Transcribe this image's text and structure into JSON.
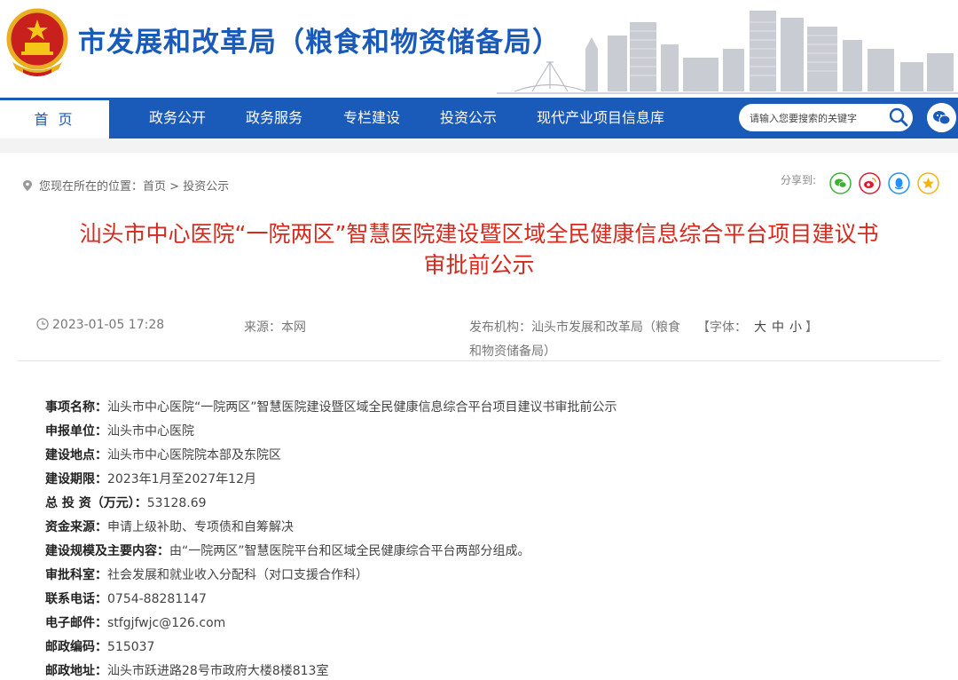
{
  "header": {
    "site_title": "市发展和改革局（粮食和物资储备局）"
  },
  "nav": {
    "items": [
      {
        "label": "首 页"
      },
      {
        "label": "政务公开"
      },
      {
        "label": "政务服务"
      },
      {
        "label": "专栏建设"
      },
      {
        "label": "投资公示"
      },
      {
        "label": "现代产业项目信息库"
      }
    ],
    "search_placeholder": "请输入您要搜索的关键字"
  },
  "breadcrumb": {
    "prefix": "您现在所在的位置：",
    "home": "首页",
    "sep": " > ",
    "current": "投资公示"
  },
  "share": {
    "label": "分享到:",
    "targets": [
      "wechat",
      "weibo",
      "qq",
      "qzone"
    ],
    "colors": {
      "wechat": "#3cb034",
      "weibo": "#e6162d",
      "qq": "#1e90ff",
      "qzone": "#f5b400"
    }
  },
  "article": {
    "title_line1": "汕头市中心医院“一院两区”智慧医院建设暨区域全民健康信息综合平台项目建议书",
    "title_line2": "审批前公示",
    "date": "2023-01-05 17:28",
    "source": "来源：本网",
    "publisher_line1": "发布机构：汕头市发展和改革局（粮食",
    "publisher_line2": "和物资储备局）",
    "font_label": "【字体：",
    "font_large": "大",
    "font_medium": "中",
    "font_small": "小",
    "font_close": "】"
  },
  "details": [
    {
      "label": "事项名称：",
      "value": "汕头市中心医院“一院两区”智慧医院建设暨区域全民健康信息综合平台项目建议书审批前公示"
    },
    {
      "label": "申报单位：",
      "value": "汕头市中心医院"
    },
    {
      "label": "建设地点：",
      "value": "汕头市中心医院院本部及东院区"
    },
    {
      "label": "建设期限：",
      "value": "2023年1月至2027年12月"
    },
    {
      "label": "总 投 资（万元）：",
      "value": "53128.69"
    },
    {
      "label": "资金来源：",
      "value": "申请上级补助、专项债和自筹解决"
    },
    {
      "label": "建设规模及主要内容：",
      "value": "由“一院两区”智慧医院平台和区域全民健康综合平台两部分组成。"
    },
    {
      "label": "审批科室：",
      "value": "社会发展和就业收入分配科（对口支援合作科）"
    },
    {
      "label": "联系电话：",
      "value": "0754-88281147"
    },
    {
      "label": "电子邮件：",
      "value": "stfgjfwjc@126.com"
    },
    {
      "label": "邮政编码：",
      "value": "515037"
    },
    {
      "label": "邮政地址：",
      "value": "汕头市跃进路28号市政府大楼8楼813室"
    }
  ],
  "colors": {
    "brand_blue": "#1a5ab8",
    "title_red": "#d62a1e"
  }
}
